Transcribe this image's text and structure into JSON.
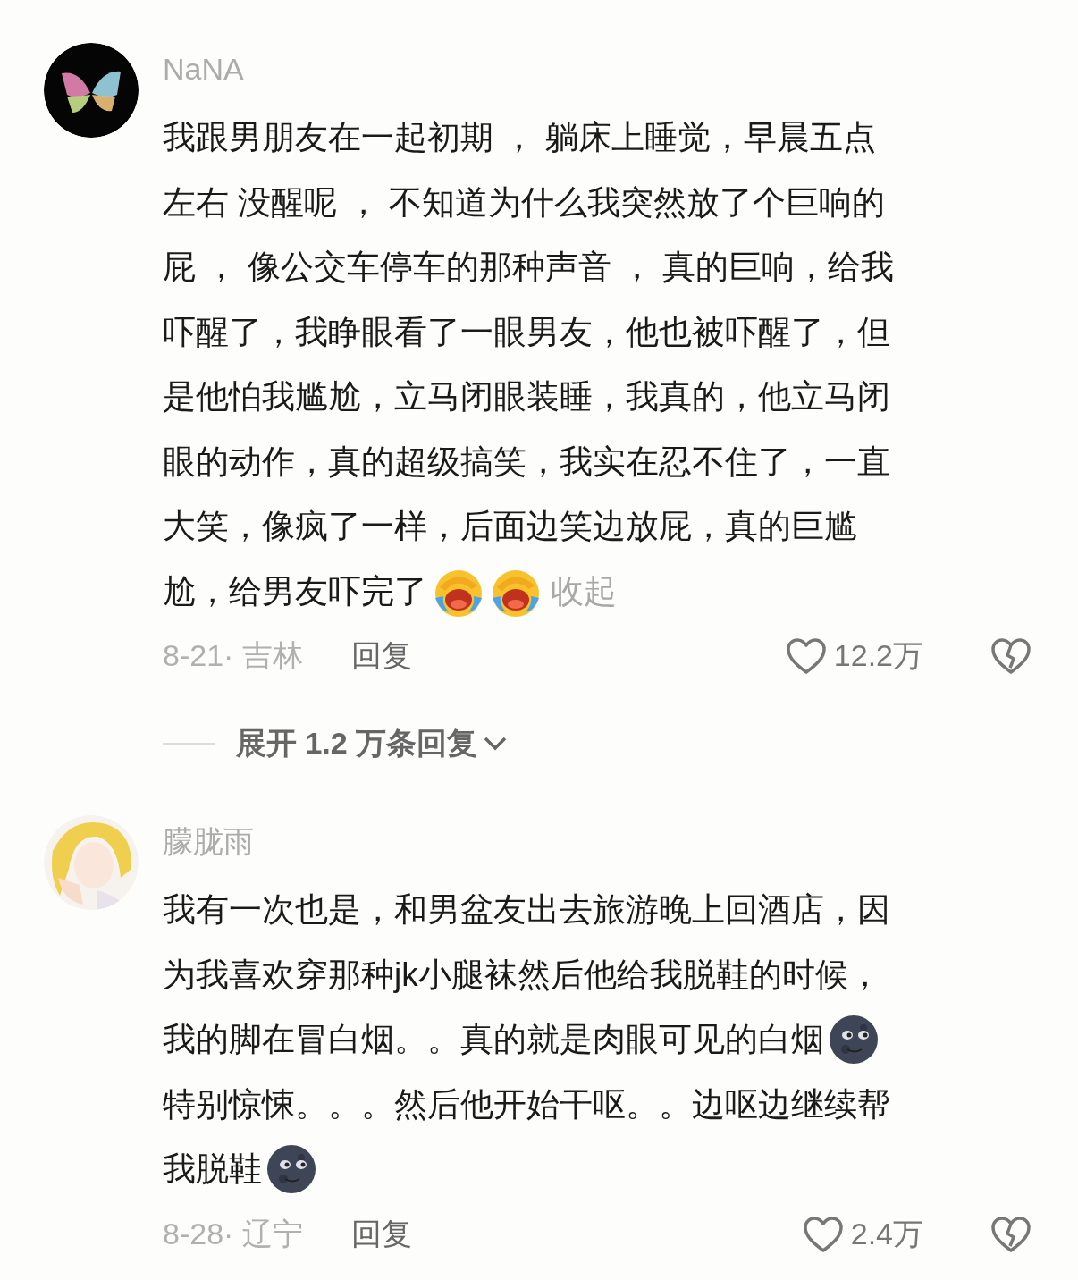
{
  "comments": [
    {
      "username": "NaNA",
      "body": [
        {
          "parts": [
            {
              "kind": "text",
              "text": "我跟男朋友在一起初期 ， 躺床上睡觉，早晨五点"
            }
          ]
        },
        {
          "parts": [
            {
              "kind": "text",
              "text": "左右 没醒呢 ， 不知道为什么我突然放了个巨响的"
            }
          ]
        },
        {
          "parts": [
            {
              "kind": "text",
              "text": "屁 ， 像公交车停车的那种声音 ， 真的巨响，给我"
            }
          ]
        },
        {
          "parts": [
            {
              "kind": "text",
              "text": "吓醒了，我睁眼看了一眼男友，他也被吓醒了，但"
            }
          ]
        },
        {
          "parts": [
            {
              "kind": "text",
              "text": "是他怕我尴尬，立马闭眼装睡，我真的，他立马闭"
            }
          ]
        },
        {
          "parts": [
            {
              "kind": "text",
              "text": "眼的动作，真的超级搞笑，我实在忍不住了，一直"
            }
          ]
        },
        {
          "parts": [
            {
              "kind": "text",
              "text": "大笑，像疯了一样，后面边笑边放屁，真的巨尴"
            }
          ]
        },
        {
          "parts": [
            {
              "kind": "text",
              "text": "尬，给男友吓完了"
            },
            {
              "kind": "laugh-cry"
            },
            {
              "kind": "laugh-cry"
            },
            {
              "kind": "link",
              "text": "收起"
            }
          ]
        }
      ],
      "date_location": "8-21· 吉林",
      "reply": "回复",
      "likes": "12.2万",
      "liked": false,
      "expand_replies": "展开 1.2 万条回复"
    },
    {
      "username": "朦胧雨",
      "body": [
        {
          "parts": [
            {
              "kind": "text",
              "text": "我有一次也是，和男盆友出去旅游晚上回酒店，因"
            }
          ]
        },
        {
          "parts": [
            {
              "kind": "text",
              "text": "为我喜欢穿那种jk小腿袜然后他给我脱鞋的时候，"
            }
          ]
        },
        {
          "parts": [
            {
              "kind": "text",
              "text": "我的脚在冒白烟。。真的就是肉眼可见的白烟"
            },
            {
              "kind": "moon"
            }
          ]
        },
        {
          "parts": [
            {
              "kind": "text",
              "text": "特别惊悚。。。然后他开始干呕。。边呕边继续帮"
            }
          ]
        },
        {
          "parts": [
            {
              "kind": "text",
              "text": "我脱鞋"
            },
            {
              "kind": "moon"
            }
          ]
        }
      ],
      "date_location": "8-28· 辽宁",
      "reply": "回复",
      "likes": "2.4万",
      "liked": false
    }
  ]
}
